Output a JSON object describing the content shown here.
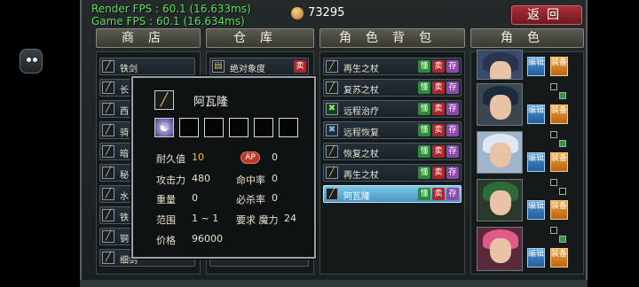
{
  "fps": {
    "render": "Render FPS : 60.1 (16.633ms)",
    "game": "Game FPS : 60.1 (16.634ms)"
  },
  "gold": {
    "amount": "73295",
    "icon": "gold-bag-icon"
  },
  "back_label": "返回",
  "headers": {
    "shop": "商店",
    "warehouse": "仓库",
    "bag": "角色背包",
    "roles": "角色"
  },
  "shop": {
    "items": [
      {
        "name": "铁剑"
      },
      {
        "name": "长"
      },
      {
        "name": "西"
      },
      {
        "name": "骑"
      },
      {
        "name": "暗"
      },
      {
        "name": "秘"
      },
      {
        "name": "水"
      },
      {
        "name": "铁"
      },
      {
        "name": "铜"
      },
      {
        "name": "细剑"
      }
    ]
  },
  "warehouse": {
    "items": [
      {
        "name": "绝对象度",
        "btn": "卖"
      }
    ]
  },
  "bag": {
    "items": [
      {
        "name": "再生之杖",
        "icon": "staff",
        "btns": [
          "懂",
          "卖",
          "存"
        ]
      },
      {
        "name": "复苏之杖",
        "icon": "staff",
        "btns": [
          "懂",
          "卖",
          "存"
        ]
      },
      {
        "name": "远程治疗",
        "icon": "green",
        "btns": [
          "懂",
          "卖",
          "存"
        ]
      },
      {
        "name": "远程恢复",
        "icon": "blue",
        "btns": [
          "懂",
          "卖",
          "存"
        ]
      },
      {
        "name": "恢复之杖",
        "icon": "staff",
        "btns": [
          "懂",
          "卖",
          "存"
        ]
      },
      {
        "name": "再生之杖",
        "icon": "staff",
        "btns": [
          "懂",
          "卖",
          "存"
        ]
      },
      {
        "name": "阿瓦隆",
        "icon": "staff",
        "btns": [
          "懂",
          "卖",
          "存"
        ],
        "selected": true
      }
    ]
  },
  "roles": {
    "btn_blue": "编辑",
    "btn_orange": "装备"
  },
  "popup": {
    "title": "阿瓦隆",
    "gem": "☯",
    "durability_label": "耐久值",
    "durability_value": "10",
    "ap_label": "AP",
    "ap_value": "0",
    "attack_label": "攻击力",
    "attack_value": "480",
    "hit_label": "命中率",
    "hit_value": "0",
    "weight_label": "重量",
    "weight_value": "0",
    "crit_label": "必杀率",
    "crit_value": "0",
    "range_label": "范围",
    "range_value": "1 ~ 1",
    "req_label": "要求 魔力",
    "req_value": "24",
    "price_label": "价格",
    "price_value": "96000"
  }
}
